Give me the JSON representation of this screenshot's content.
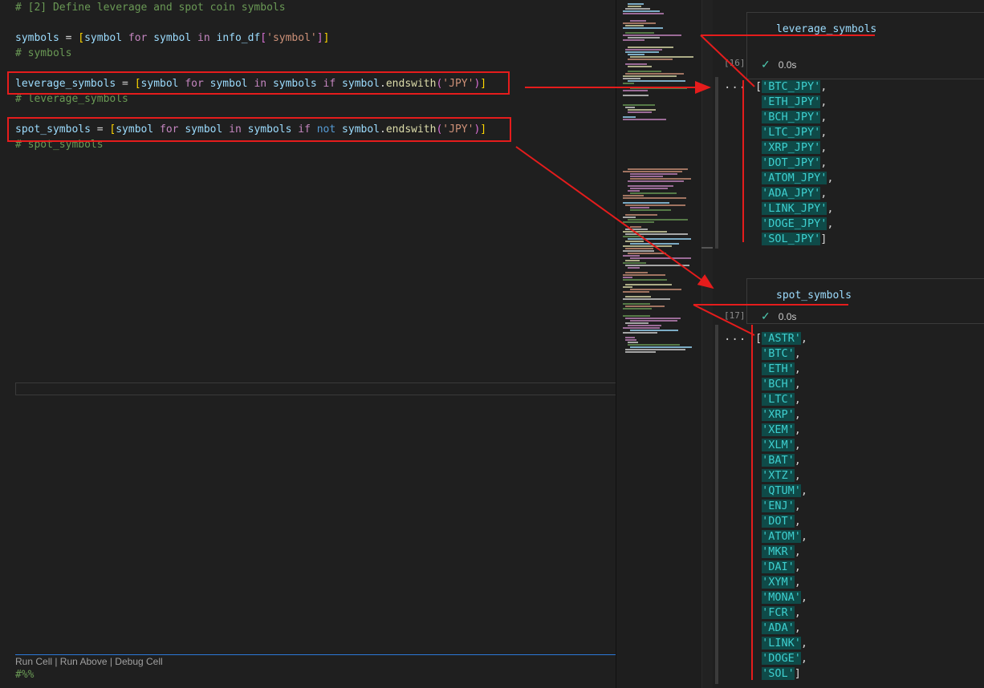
{
  "editor": {
    "comment_header": "# [2] Define leverage and spot coin symbols",
    "line_symbols": {
      "var": "symbols",
      "eq": " = ",
      "open": "[",
      "a": "symbol",
      "for": " for ",
      "b": "symbol",
      "in": " in ",
      "obj": "info_df",
      "key_open": "[",
      "key": "'symbol'",
      "key_close": "]",
      "close": "]"
    },
    "comment_symbols": "# symbols",
    "line_leverage": {
      "var": "leverage_symbols",
      "eq": " = ",
      "open": "[",
      "a": "symbol",
      "for": " for ",
      "b": "symbol",
      "in": " in ",
      "src": "symbols",
      "if": " if ",
      "c": "symbol",
      "dot": ".",
      "method": "endswith",
      "p_open": "(",
      "arg": "'JPY'",
      "p_close": ")",
      "close": "]"
    },
    "comment_leverage": "# leverage_symbols",
    "line_spot": {
      "var": "spot_symbols",
      "eq": " = ",
      "open": "[",
      "a": "symbol",
      "for": " for ",
      "b": "symbol",
      "in": " in ",
      "src": "symbols",
      "if": " if ",
      "not": "not ",
      "c": "symbol",
      "dot": ".",
      "method": "endswith",
      "p_open": "(",
      "arg": "'JPY'",
      "p_close": ")",
      "close": "]"
    },
    "comment_spot": "# spot_symbols",
    "codelens": "Run Cell | Run Above | Debug Cell",
    "cell_marker": "#%%"
  },
  "notebook": {
    "cell16": {
      "code": "leverage_symbols",
      "exec_count": "[16]",
      "time": "0.0s",
      "output_menu": "...",
      "output": [
        "BTC_JPY",
        "ETH_JPY",
        "BCH_JPY",
        "LTC_JPY",
        "XRP_JPY",
        "DOT_JPY",
        "ATOM_JPY",
        "ADA_JPY",
        "LINK_JPY",
        "DOGE_JPY",
        "SOL_JPY"
      ]
    },
    "cell17": {
      "code": "spot_symbols",
      "exec_count": "[17]",
      "time": "0.0s",
      "output_menu": "...",
      "output": [
        "ASTR",
        "BTC",
        "ETH",
        "BCH",
        "LTC",
        "XRP",
        "XEM",
        "XLM",
        "BAT",
        "XTZ",
        "QTUM",
        "ENJ",
        "DOT",
        "ATOM",
        "MKR",
        "DAI",
        "XYM",
        "MONA",
        "FCR",
        "ADA",
        "LINK",
        "DOGE",
        "SOL"
      ]
    }
  },
  "colors": {
    "annotation": "#e51c1c",
    "string_highlight": "#0f4a48"
  },
  "icons": {
    "status_check": "check-icon"
  }
}
